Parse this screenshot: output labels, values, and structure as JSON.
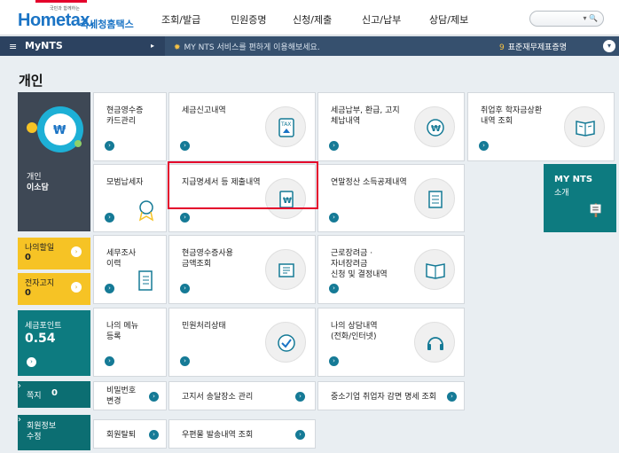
{
  "header": {
    "logo_small": "국민과 함께하는",
    "logo_main": "Hometax,",
    "logo_kr": "국세청홈택스",
    "menu": [
      "조회/발급",
      "민원증명",
      "신청/제출",
      "신고/납부",
      "상담/제보"
    ]
  },
  "nav": {
    "menu_label": "MyNTS",
    "message": "MY NTS 서비스를 편하게 이용해보세요.",
    "right_num": "9",
    "right_label": "표준재무제표증명"
  },
  "section_title": "개인",
  "profile": {
    "line1": "개인",
    "line2": "이소담"
  },
  "side": {
    "todo_label": "나의할일",
    "todo_value": "0",
    "notice_label": "전자고지",
    "notice_value": "0",
    "points_label": "세금포인트",
    "points_value": "0.54",
    "note_label": "쪽지",
    "note_value": "0",
    "member_label": "회원정보\n수정"
  },
  "tiles": {
    "cash": "현금영수증\n카드관리",
    "tax_report": "세금신고내역",
    "payment": "세금납부, 환급, 고지\n체납내역",
    "student": "취업후 학자금상환\n내역 조회",
    "model": "모범납세자",
    "statement": "지급명세서 등 제출내역",
    "yearend": "연말정산 소득공제내역",
    "audit": "세무조사\n이력",
    "cash_use": "현금영수증사용\n금액조회",
    "earned": "근로장려금 ·\n자녀장려금\n신청 및 결정내역",
    "mymenu": "나의 메뉴\n등록",
    "civil": "민원처리상태",
    "consult": "나의 상담내역\n(전화/인터넷)",
    "password": "비밀번호\n변경",
    "address": "고지서 송달장소 관리",
    "sme": "중소기업 취업자 감면 명세 조회",
    "withdraw": "회원탈퇴",
    "mail": "우편물 발송내역 조회"
  },
  "mynts": {
    "title": "MY NTS",
    "sub": "소개"
  }
}
